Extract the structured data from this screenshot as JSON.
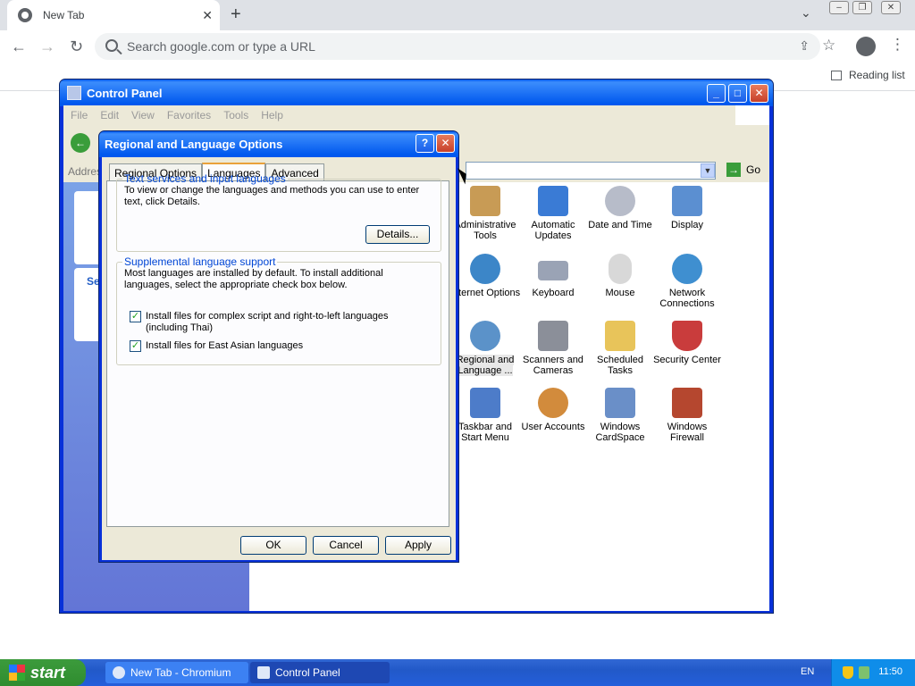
{
  "browser": {
    "tab_title": "New Tab",
    "omnibox_placeholder": "Search google.com or type a URL",
    "reading_list": "Reading list"
  },
  "control_panel": {
    "title": "Control Panel",
    "menu": [
      "File",
      "Edit",
      "View",
      "Favorites",
      "Tools",
      "Help"
    ],
    "address_label": "Addres",
    "go_label": "Go",
    "left_partial": "Se",
    "icons": [
      {
        "label": "Administrative Tools",
        "color": "#c89b55"
      },
      {
        "label": "Automatic Updates",
        "color": "#3a7bd5"
      },
      {
        "label": "Date and Time",
        "color": "#b7bcc9"
      },
      {
        "label": "Display",
        "color": "#5b8fd1"
      },
      {
        "label": "Internet Options",
        "color": "#3c86c8"
      },
      {
        "label": "Keyboard",
        "color": "#9aa3b5"
      },
      {
        "label": "Mouse",
        "color": "#d8d8d8"
      },
      {
        "label": "Network Connections",
        "color": "#3f8fd0"
      },
      {
        "label": "Regional and Language ...",
        "color": "#3e7fc0"
      },
      {
        "label": "Scanners and Cameras",
        "color": "#8b8f99"
      },
      {
        "label": "Scheduled Tasks",
        "color": "#e8c45a"
      },
      {
        "label": "Security Center",
        "color": "#c93c3c"
      },
      {
        "label": "Taskbar and Start Menu",
        "color": "#4d7cc9"
      },
      {
        "label": "User Accounts",
        "color": "#d28b3c"
      },
      {
        "label": "Windows CardSpace",
        "color": "#6a8fc8"
      },
      {
        "label": "Windows Firewall",
        "color": "#b5472f"
      }
    ]
  },
  "dialog": {
    "title": "Regional and Language Options",
    "help_btn": "?",
    "tabs": [
      "Regional Options",
      "Languages",
      "Advanced"
    ],
    "active_tab": "Languages",
    "group1": {
      "legend": "Text services and input languages",
      "text": "To view or change the languages and methods you can use to enter text, click Details.",
      "details_button": "Details..."
    },
    "group2": {
      "legend": "Supplemental language support",
      "text": "Most languages are installed by default. To install additional languages, select the appropriate check box below.",
      "check1": "Install files for complex script and right-to-left languages (including Thai)",
      "check2": "Install files for East Asian languages"
    },
    "ok": "OK",
    "cancel": "Cancel",
    "apply": "Apply"
  },
  "taskbar": {
    "start": "start",
    "task1": "New Tab - Chromium",
    "task2": "Control Panel",
    "lang": "EN",
    "clock": "11:50"
  }
}
